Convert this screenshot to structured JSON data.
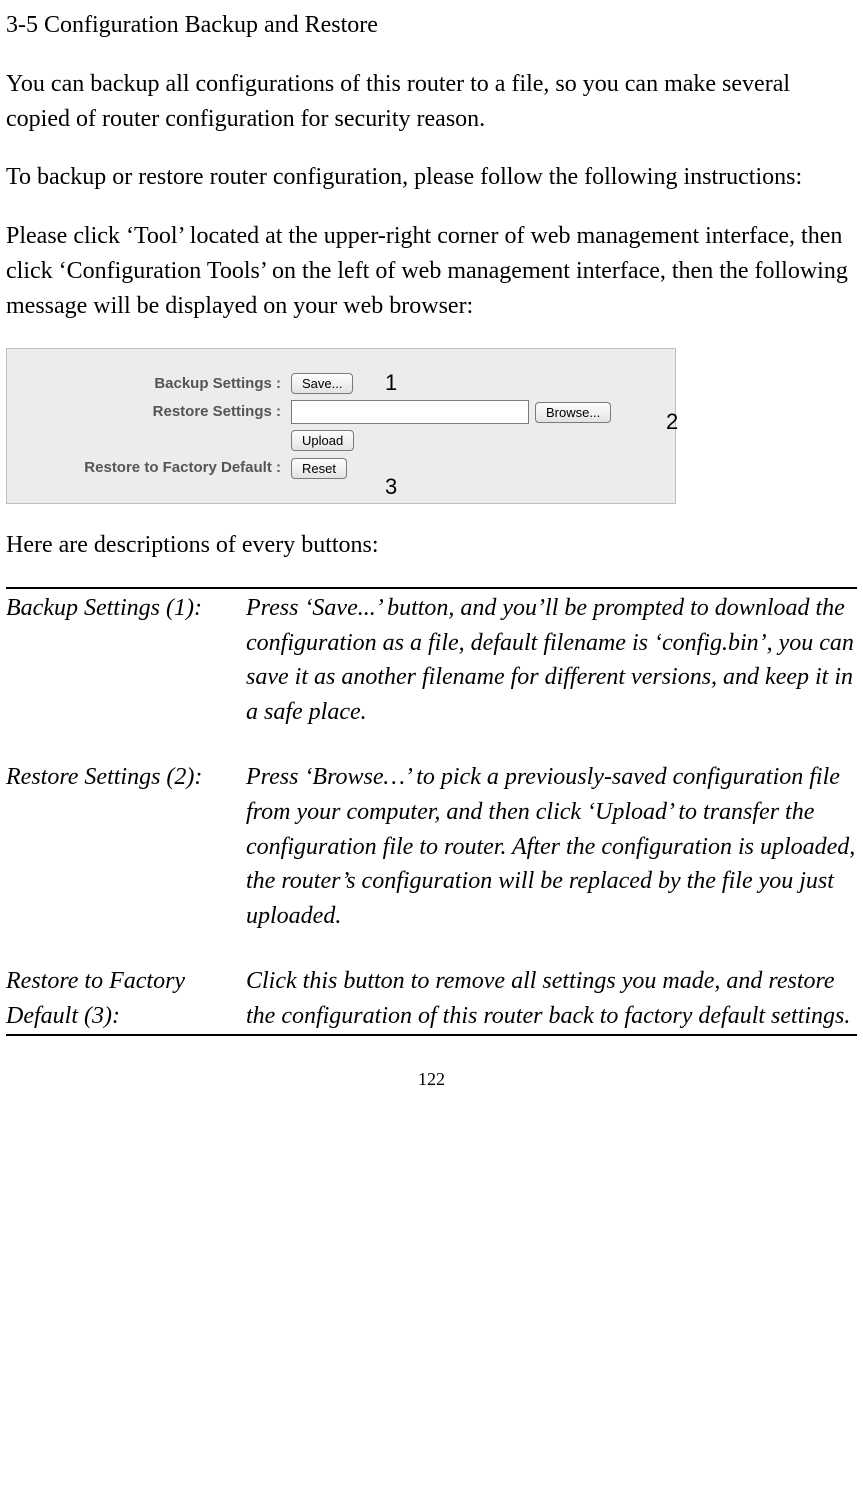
{
  "heading": "3‑5 Configuration Backup and Restore",
  "para1": "You can backup all configurations of this router to a file, so you can make several copied of router configuration for security reason.",
  "para2": "To backup or restore router configuration, please follow the following instructions:",
  "para3": "Please click ‘Tool’ located at the upper-right corner of web management interface, then click ‘Configuration Tools’ on the left of web management interface, then the following message will be displayed on your web browser:",
  "screenshot": {
    "rows": {
      "backup_label": "Backup Settings :",
      "restore_label": "Restore Settings :",
      "factory_label": "Restore to Factory Default :"
    },
    "buttons": {
      "save": "Save...",
      "browse": "Browse...",
      "upload": "Upload",
      "reset": "Reset"
    },
    "file_value": "",
    "annotations": {
      "a1": "1",
      "a2": "2",
      "a3": "3"
    }
  },
  "descriptions_intro": "Here are descriptions of every buttons:",
  "descriptions": [
    {
      "key": "Backup Settings (1):",
      "val": "Press ‘Save...’ button, and you’ll be prompted to download the configuration as a file, default filename is ‘config.bin’, you can save it as another filename for different versions, and keep it in a safe place."
    },
    {
      "key": "Restore Settings (2):",
      "val": "Press ‘Browse…’ to pick a previously-saved configuration file from your computer, and then click ‘Upload’ to transfer the configuration file to router. After the configuration is uploaded, the router’s configuration will be replaced by the file you just uploaded."
    },
    {
      "key": "Restore to Factory Default (3):",
      "val": "Click this button to remove all settings you made, and restore the configuration of this router back to factory default settings."
    }
  ],
  "page_number": "122"
}
